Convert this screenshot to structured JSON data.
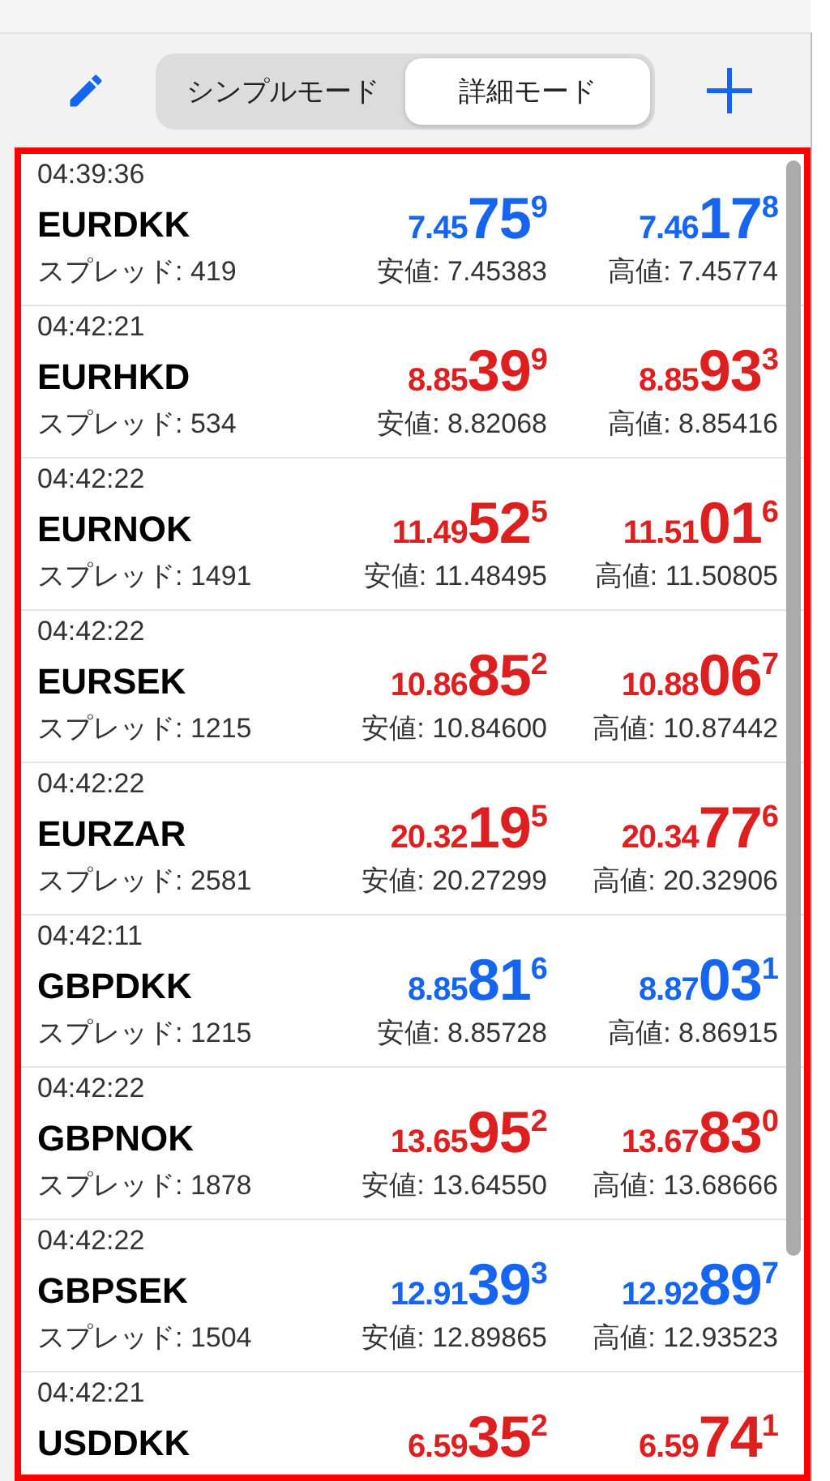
{
  "toolbar": {
    "mode_tabs": [
      {
        "label": "シンプルモード",
        "selected": false
      },
      {
        "label": "詳細モード",
        "selected": true
      }
    ]
  },
  "quotes": [
    {
      "time": "04:39:36",
      "symbol": "EURDKK",
      "color": "#1565f0",
      "bid": {
        "prefix": "7.45",
        "big": "75",
        "sup": "9"
      },
      "ask": {
        "prefix": "7.46",
        "big": "17",
        "sup": "8"
      },
      "spread": "スプレッド: 419",
      "low": "安値: 7.45383",
      "high": "高値: 7.45774"
    },
    {
      "time": "04:42:21",
      "symbol": "EURHKD",
      "color": "#dd1f1f",
      "bid": {
        "prefix": "8.85",
        "big": "39",
        "sup": "9"
      },
      "ask": {
        "prefix": "8.85",
        "big": "93",
        "sup": "3"
      },
      "spread": "スプレッド: 534",
      "low": "安値: 8.82068",
      "high": "高値: 8.85416"
    },
    {
      "time": "04:42:22",
      "symbol": "EURNOK",
      "color": "#dd1f1f",
      "bid": {
        "prefix": "11.49",
        "big": "52",
        "sup": "5"
      },
      "ask": {
        "prefix": "11.51",
        "big": "01",
        "sup": "6"
      },
      "spread": "スプレッド: 1491",
      "low": "安値: 11.48495",
      "high": "高値: 11.50805"
    },
    {
      "time": "04:42:22",
      "symbol": "EURSEK",
      "color": "#dd1f1f",
      "bid": {
        "prefix": "10.86",
        "big": "85",
        "sup": "2"
      },
      "ask": {
        "prefix": "10.88",
        "big": "06",
        "sup": "7"
      },
      "spread": "スプレッド: 1215",
      "low": "安値: 10.84600",
      "high": "高値: 10.87442"
    },
    {
      "time": "04:42:22",
      "symbol": "EURZAR",
      "color": "#dd1f1f",
      "bid": {
        "prefix": "20.32",
        "big": "19",
        "sup": "5"
      },
      "ask": {
        "prefix": "20.34",
        "big": "77",
        "sup": "6"
      },
      "spread": "スプレッド: 2581",
      "low": "安値: 20.27299",
      "high": "高値: 20.32906"
    },
    {
      "time": "04:42:11",
      "symbol": "GBPDKK",
      "color": "#1565f0",
      "bid": {
        "prefix": "8.85",
        "big": "81",
        "sup": "6"
      },
      "ask": {
        "prefix": "8.87",
        "big": "03",
        "sup": "1"
      },
      "spread": "スプレッド: 1215",
      "low": "安値: 8.85728",
      "high": "高値: 8.86915"
    },
    {
      "time": "04:42:22",
      "symbol": "GBPNOK",
      "color": "#dd1f1f",
      "bid": {
        "prefix": "13.65",
        "big": "95",
        "sup": "2"
      },
      "ask": {
        "prefix": "13.67",
        "big": "83",
        "sup": "0"
      },
      "spread": "スプレッド: 1878",
      "low": "安値: 13.64550",
      "high": "高値: 13.68666"
    },
    {
      "time": "04:42:22",
      "symbol": "GBPSEK",
      "color": "#1565f0",
      "bid": {
        "prefix": "12.91",
        "big": "39",
        "sup": "3"
      },
      "ask": {
        "prefix": "12.92",
        "big": "89",
        "sup": "7"
      },
      "spread": "スプレッド: 1504",
      "low": "安値: 12.89865",
      "high": "高値: 12.93523"
    },
    {
      "time": "04:42:21",
      "symbol": "USDDKK",
      "color": "#dd1f1f",
      "bid": {
        "prefix": "6.59",
        "big": "35",
        "sup": "2"
      },
      "ask": {
        "prefix": "6.59",
        "big": "74",
        "sup": "1"
      }
    }
  ]
}
